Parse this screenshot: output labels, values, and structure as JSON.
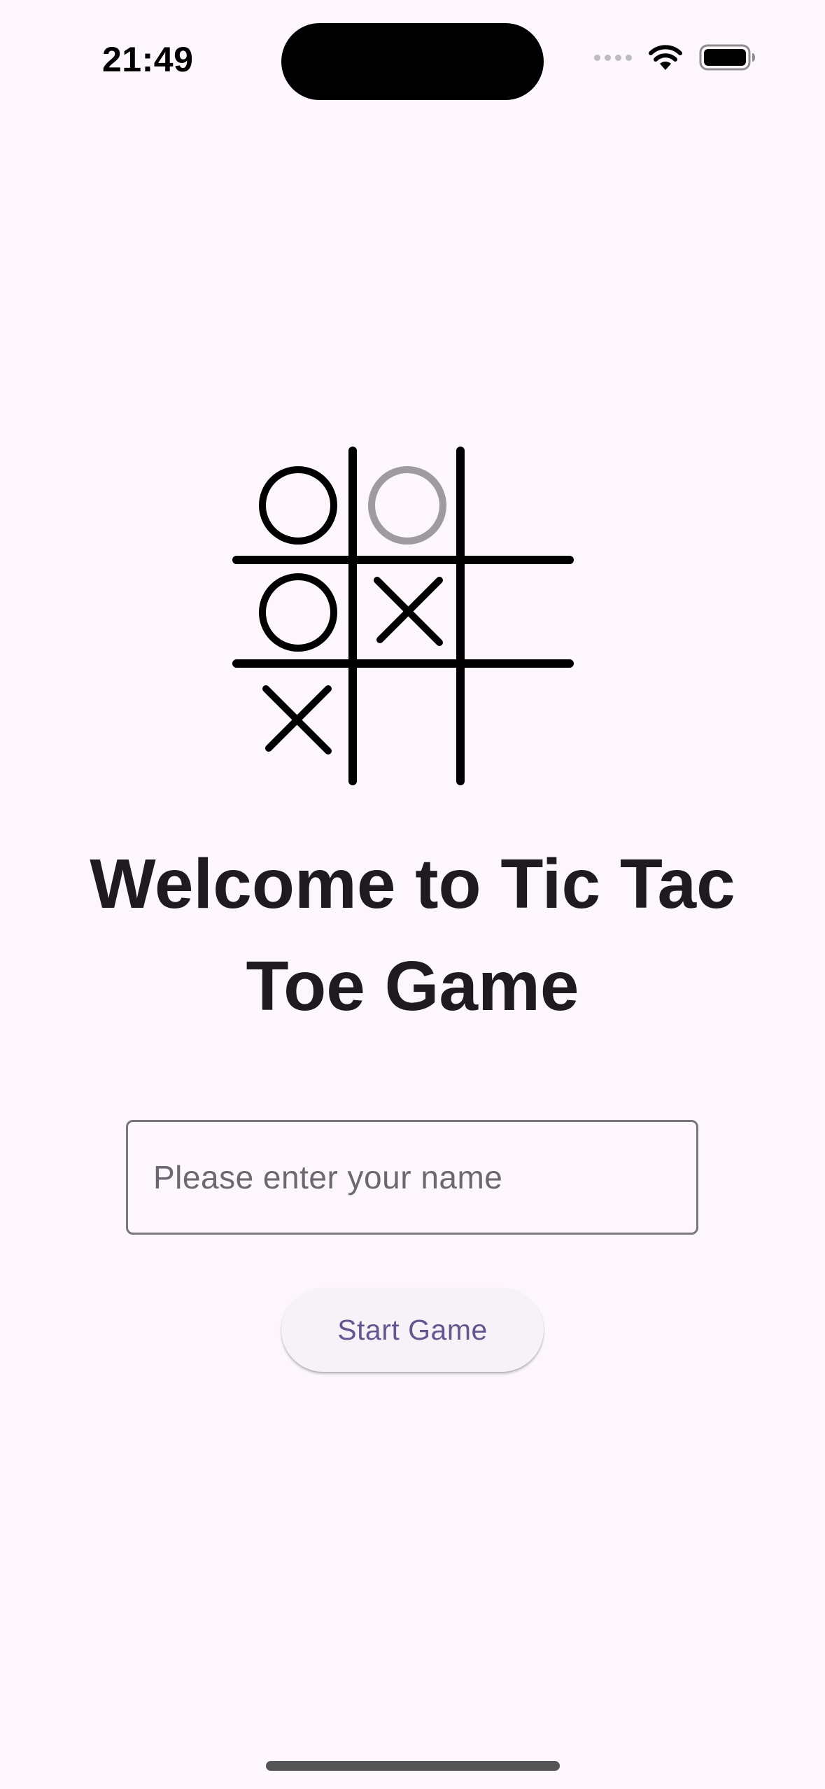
{
  "status_bar": {
    "time": "21:49",
    "icons": [
      "cellular-signal-icon",
      "wifi-icon",
      "battery-icon"
    ]
  },
  "logo": {
    "icon": "tic-tac-toe-logo",
    "board": [
      [
        "O",
        "O",
        ""
      ],
      [
        "O",
        "X",
        ""
      ],
      [
        "X",
        "",
        ""
      ]
    ],
    "colors": {
      "stroke": "#000000",
      "faded_o": "#9E9A9E"
    }
  },
  "title": "Welcome to Tic Tac Toe Game",
  "name_input": {
    "value": "",
    "placeholder": "Please enter your name"
  },
  "start_button": {
    "label": "Start Game"
  },
  "colors": {
    "background": "#FDF7FD",
    "text": "#1D1B20",
    "button_text": "#65558F",
    "input_border": "#79747E"
  }
}
